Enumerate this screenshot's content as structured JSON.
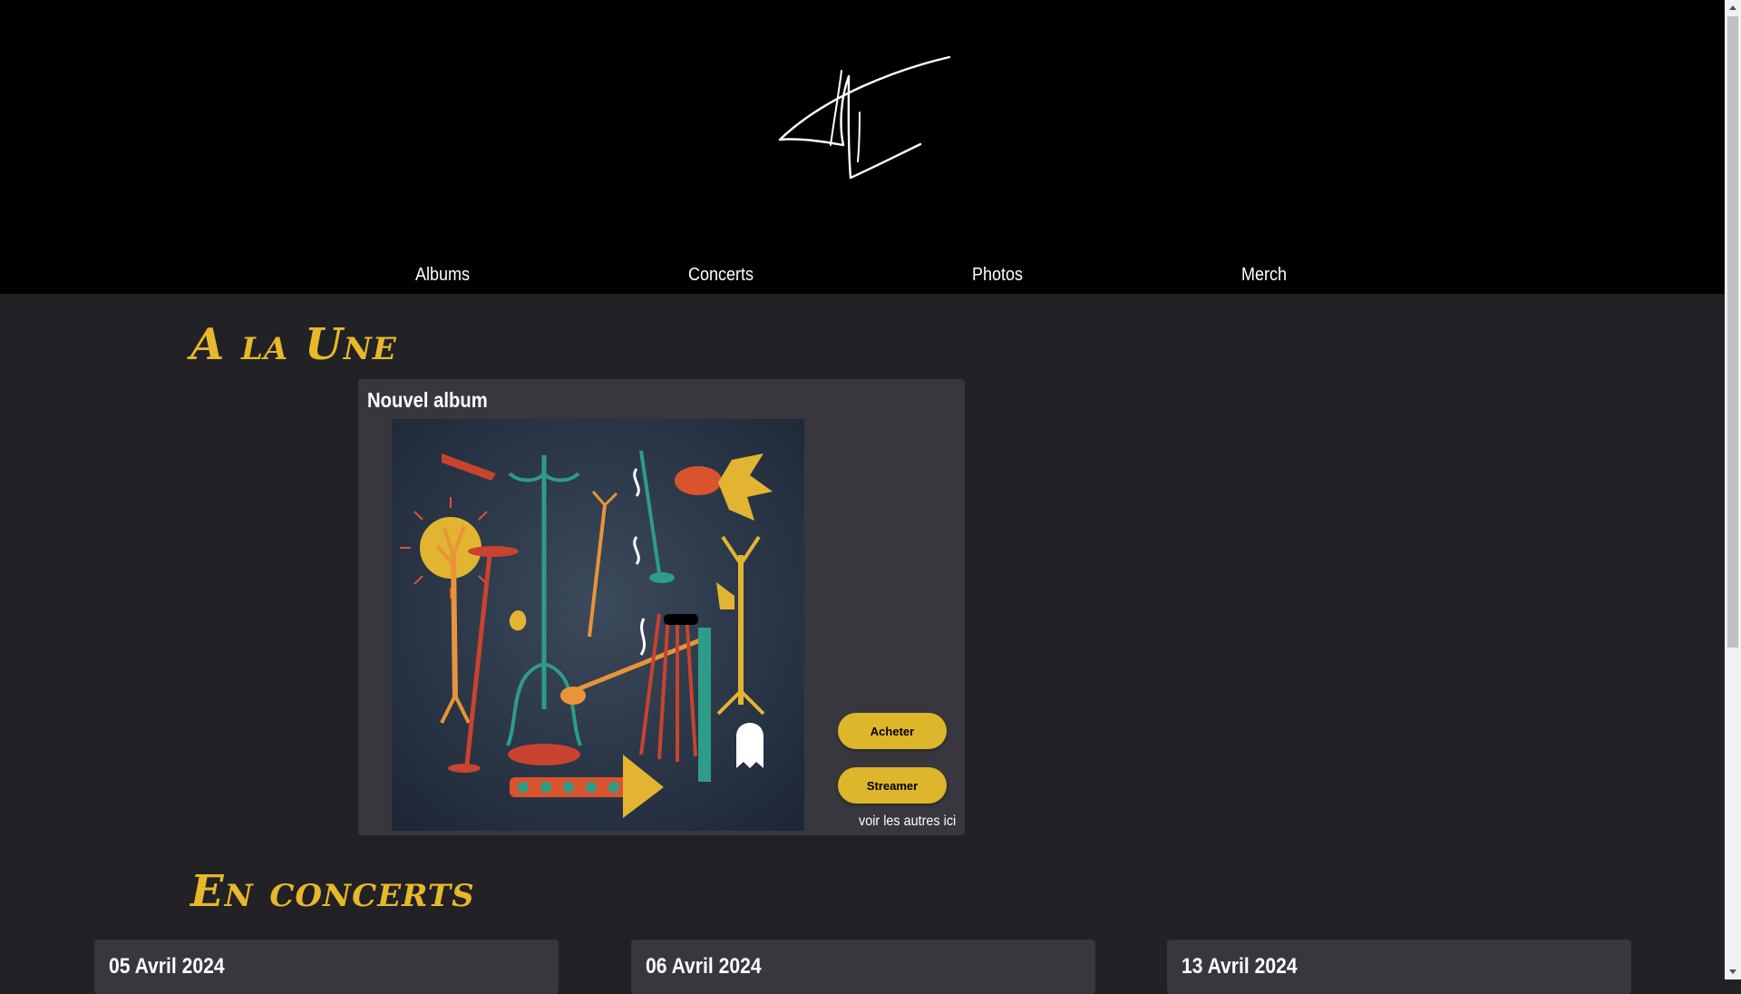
{
  "nav": {
    "items": [
      {
        "label": "Albums"
      },
      {
        "label": "Concerts"
      },
      {
        "label": "Photos"
      },
      {
        "label": "Merch"
      }
    ]
  },
  "featured": {
    "section_title": "A la Une",
    "card_title": "Nouvel album",
    "buy_label": "Acheter",
    "stream_label": "Streamer",
    "see_more": "voir les autres ici"
  },
  "concerts": {
    "section_title": "En concerts",
    "dates": [
      "05 Avril 2024",
      "06 Avril 2024",
      "13 Avril 2024"
    ]
  },
  "colors": {
    "accent": "#ddb62b",
    "title": "#e6b82a",
    "background": "#222126",
    "card": "#38373d",
    "header": "#000000"
  },
  "icons": {
    "logo": "signature-logo",
    "scroll_up": "scroll-up-arrow-icon",
    "scroll_down": "scroll-down-arrow-icon"
  }
}
